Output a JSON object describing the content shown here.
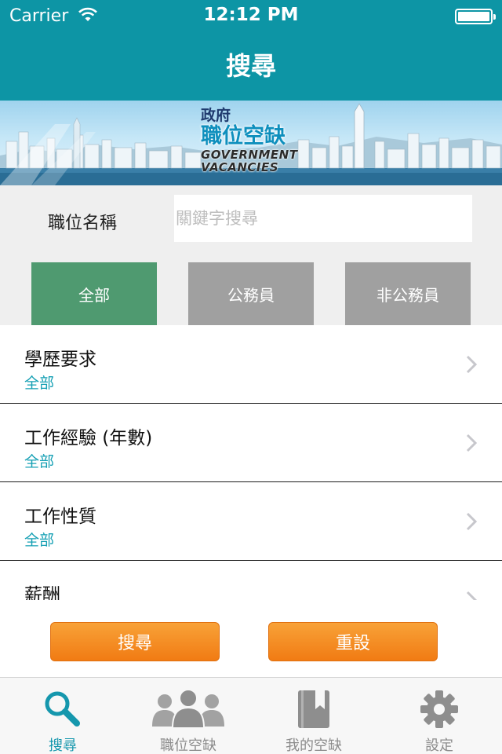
{
  "status_bar": {
    "carrier": "Carrier",
    "time": "12:12 PM"
  },
  "nav": {
    "title": "搜尋"
  },
  "banner": {
    "line1": "政府",
    "line2": "職位空缺",
    "line3": "GOVERNMENT",
    "line4": "VACANCIES"
  },
  "filter": {
    "label": "職位名稱",
    "placeholder": "關鍵字搜尋",
    "tabs": [
      {
        "label": "全部",
        "selected": true
      },
      {
        "label": "公務員",
        "selected": false
      },
      {
        "label": "非公務員",
        "selected": false
      }
    ]
  },
  "rows": [
    {
      "title": "學歷要求",
      "value": "全部"
    },
    {
      "title": "工作經驗 (年數)",
      "value": "全部"
    },
    {
      "title": "工作性質",
      "value": "全部"
    },
    {
      "title": "薪酬",
      "value": ""
    }
  ],
  "actions": {
    "search": "搜尋",
    "reset": "重設"
  },
  "tabbar": [
    {
      "label": "搜尋",
      "icon": "search-icon",
      "active": true
    },
    {
      "label": "職位空缺",
      "icon": "people-icon",
      "active": false
    },
    {
      "label": "我的空缺",
      "icon": "bookmark-book-icon",
      "active": false
    },
    {
      "label": "設定",
      "icon": "gear-icon",
      "active": false
    }
  ],
  "colors": {
    "header": "#0d95a5",
    "accent": "#1597ad",
    "tab_active": "#4f9a70",
    "tab_inactive": "#a0a0a0",
    "button": "#f17b13"
  }
}
